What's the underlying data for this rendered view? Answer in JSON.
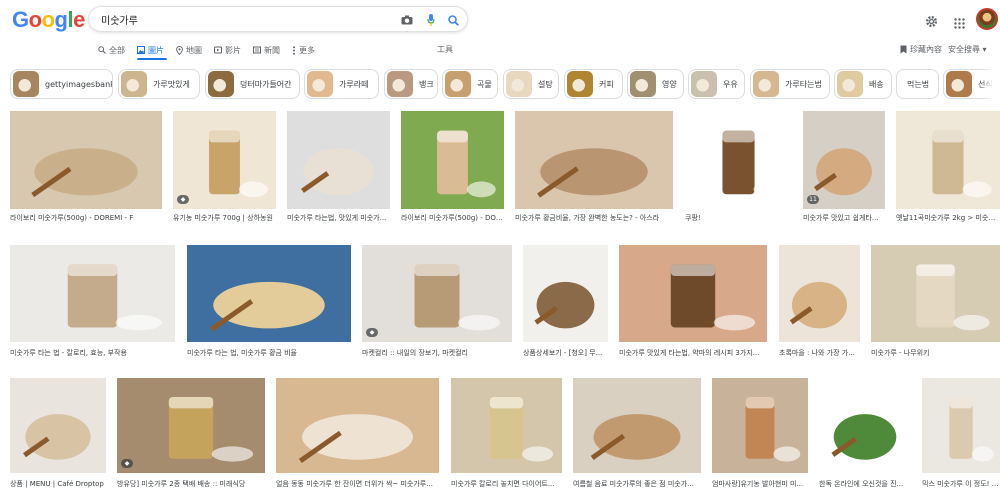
{
  "header": {
    "logo_text": "Google",
    "search_value": "미숫가루",
    "search_placeholder": ""
  },
  "tabs": [
    {
      "label": "全部",
      "icon": "search-icon"
    },
    {
      "label": "圖片",
      "icon": "image-icon",
      "active": true
    },
    {
      "label": "地圖",
      "icon": "map-pin-icon"
    },
    {
      "label": "影片",
      "icon": "video-icon"
    },
    {
      "label": "新聞",
      "icon": "news-icon"
    },
    {
      "label": "更多",
      "icon": "more-dots-icon"
    }
  ],
  "tools_label": "工具",
  "saved_label": "珍藏內容",
  "safe_search_label": "安全搜尋 ▾",
  "colors": {
    "accent": "#1a73e8",
    "logo_blue": "#4285f4",
    "logo_red": "#ea4335",
    "logo_yellow": "#fbbc05",
    "logo_green": "#34a853"
  },
  "chips": [
    {
      "label": "gettyimagesbank",
      "thumb": "#a7855f"
    },
    {
      "label": "가루맛있게",
      "thumb": "#cdb58f"
    },
    {
      "label": "덩터마가들어간",
      "thumb": "#8c6b3f"
    },
    {
      "label": "가루라떼",
      "thumb": "#e2b98f"
    },
    {
      "label": "뱅크",
      "thumb": "#b99a80"
    },
    {
      "label": "곡물",
      "thumb": "#c8a070"
    },
    {
      "label": "설탕",
      "thumb": "#e8d8c0"
    },
    {
      "label": "커피",
      "thumb": "#b0852f"
    },
    {
      "label": "영양",
      "thumb": "#a09070"
    },
    {
      "label": "우유",
      "thumb": "#c9c0b0"
    },
    {
      "label": "가루타는법",
      "thumb": "#d5b890"
    },
    {
      "label": "배송",
      "thumb": "#e0cba0"
    },
    {
      "label": "먹는법",
      "thumb": ""
    },
    {
      "label": "선식",
      "thumb": "#b07b4a"
    }
  ],
  "rows": [
    [
      {
        "caption": "라이보리 미숫가루(500g) - DOREMI - F",
        "bg": "#d9c8b0",
        "fg": "#c9b08a"
      },
      {
        "caption": "유기농 미숫가루 700g | 상하농원",
        "bg": "#efe6d6",
        "fg": "#c8a46a",
        "badge": true
      },
      {
        "caption": "미숫가루 타는법, 맛있게 미숫가...",
        "bg": "#dedede",
        "fg": "#e8e0d5"
      },
      {
        "caption": "라이보리 미숫가루(500g) - DOR...",
        "bg": "#7faa4f",
        "fg": "#d9bb94"
      },
      {
        "caption": "미숫가루 황금비율, 가장 완벽한 농도는? - 아스라",
        "bg": "#d9c6ad",
        "fg": "#b99572"
      },
      {
        "caption": "쿠팡!",
        "bg": "#ffffff",
        "fg": "#7a5230"
      },
      {
        "caption": "미숫가루 맛있고 쉽게타...",
        "bg": "#d6cfc6",
        "fg": "#d4aa80",
        "badge_text": "11"
      },
      {
        "caption": "옛날11곡미숫가루 2kg > 미숫가...",
        "bg": "#efe7d8",
        "fg": "#cfb995"
      }
    ],
    [
      {
        "caption": "미숫가루 타는 법 - 칼로리, 효능, 부작용",
        "bg": "#eceae6",
        "fg": "#c4ab8c"
      },
      {
        "caption": "미숫가루 타는 법, 미숫가루 황금 비율",
        "bg": "#3e6fa0",
        "fg": "#e3cc9a"
      },
      {
        "caption": "마켓컬리 :: 내일의 장보기, 마켓컬리",
        "bg": "#e2dfda",
        "fg": "#b79a76",
        "badge": true
      },
      {
        "caption": "상품상세보기 - [청오] 무...",
        "bg": "#f2f0ec",
        "fg": "#8a6a48"
      },
      {
        "caption": "미숫가루 맛있게 타는법, 약마의 레시피 3가지...",
        "bg": "#d7a98a",
        "fg": "#6f4a2a"
      },
      {
        "caption": "초록마을 : 나와 가장 가...",
        "bg": "#ece4d9",
        "fg": "#d8b385"
      },
      {
        "caption": "미숫가루 - 나무위키",
        "bg": "#d6cbb3",
        "fg": "#e4d8c2"
      }
    ],
    [
      {
        "caption": "상품 | MENU | Café Droptop",
        "bg": "#e9e4dd",
        "fg": "#d9c3a5"
      },
      {
        "caption": "방유당] 미숫가루 2종 택배 배송 :: 미래식당",
        "bg": "#a58c6e",
        "fg": "#c4a45d",
        "badge": true
      },
      {
        "caption": "얼음 동동 미숫가루 한 잔이면 더위가 싹~ 미숫가루...",
        "bg": "#d7b891",
        "fg": "#eee3d2"
      },
      {
        "caption": "미숫가루 칼로리 놓치면 다이어트...",
        "bg": "#d3c6ab",
        "fg": "#d7c590"
      },
      {
        "caption": "여름철 음료 미숫가루의 좋은 점 미숫가...",
        "bg": "#d9d0c2",
        "fg": "#c19a70"
      },
      {
        "caption": "엄마사랑]유기농 발아현미 미...",
        "bg": "#c8b299",
        "fg": "#c18654"
      },
      {
        "caption": "한독 온라인에 오신것을 진...",
        "bg": "#ffffff",
        "fg": "#4f8a3a"
      },
      {
        "caption": "믹스 미숫가루 이 정도! 미...",
        "bg": "#ebe7e1",
        "fg": "#dccab0"
      }
    ]
  ]
}
